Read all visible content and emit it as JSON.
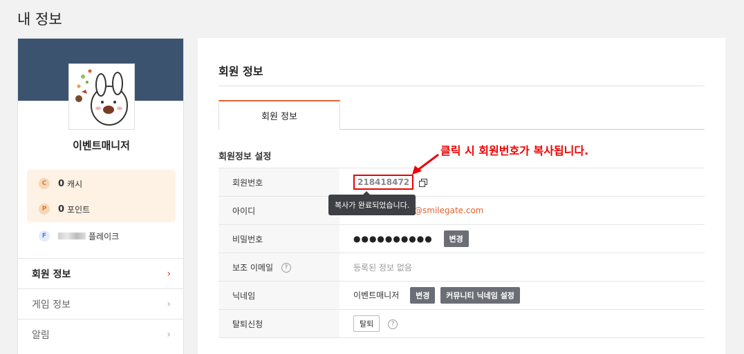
{
  "page": {
    "title": "내 정보"
  },
  "profile": {
    "nickname": "이벤트매니저",
    "wallet": {
      "cash": {
        "badge": "C",
        "amount": "0",
        "label": "캐시"
      },
      "point": {
        "badge": "P",
        "amount": "0",
        "label": "포인트"
      }
    },
    "flake": {
      "badge": "F",
      "label": "플레이크"
    }
  },
  "sidebar": {
    "items": [
      {
        "label": "회원 정보",
        "active": true
      },
      {
        "label": "게임 정보",
        "active": false
      },
      {
        "label": "알림",
        "active": false
      }
    ]
  },
  "main": {
    "section_title": "회원 정보",
    "tab_label": "회원 정보",
    "sub_title": "회원정보 설정",
    "rows": {
      "member_no": {
        "label": "회원번호",
        "value": "218418472"
      },
      "id": {
        "label": "아이디",
        "value": "@smilegate.com"
      },
      "password": {
        "label": "비밀번호",
        "value": "●●●●●●●●●●",
        "button": "변경"
      },
      "backup_email": {
        "label": "보조 이메일",
        "value": "등록된 정보 없음"
      },
      "nickname": {
        "label": "닉네임",
        "value": "이벤트매니저",
        "button": "변경",
        "button2": "커뮤니티 닉네임 설정"
      },
      "withdraw": {
        "label": "탈퇴신청",
        "button": "탈퇴"
      }
    },
    "tooltip": "복사가 완료되었습니다."
  },
  "annotation": {
    "text": "클릭 시 회원번호가 복사됩니다."
  },
  "colors": {
    "banner": "#3c5370",
    "accent": "#e2632d",
    "highlight": "#ee0000"
  }
}
